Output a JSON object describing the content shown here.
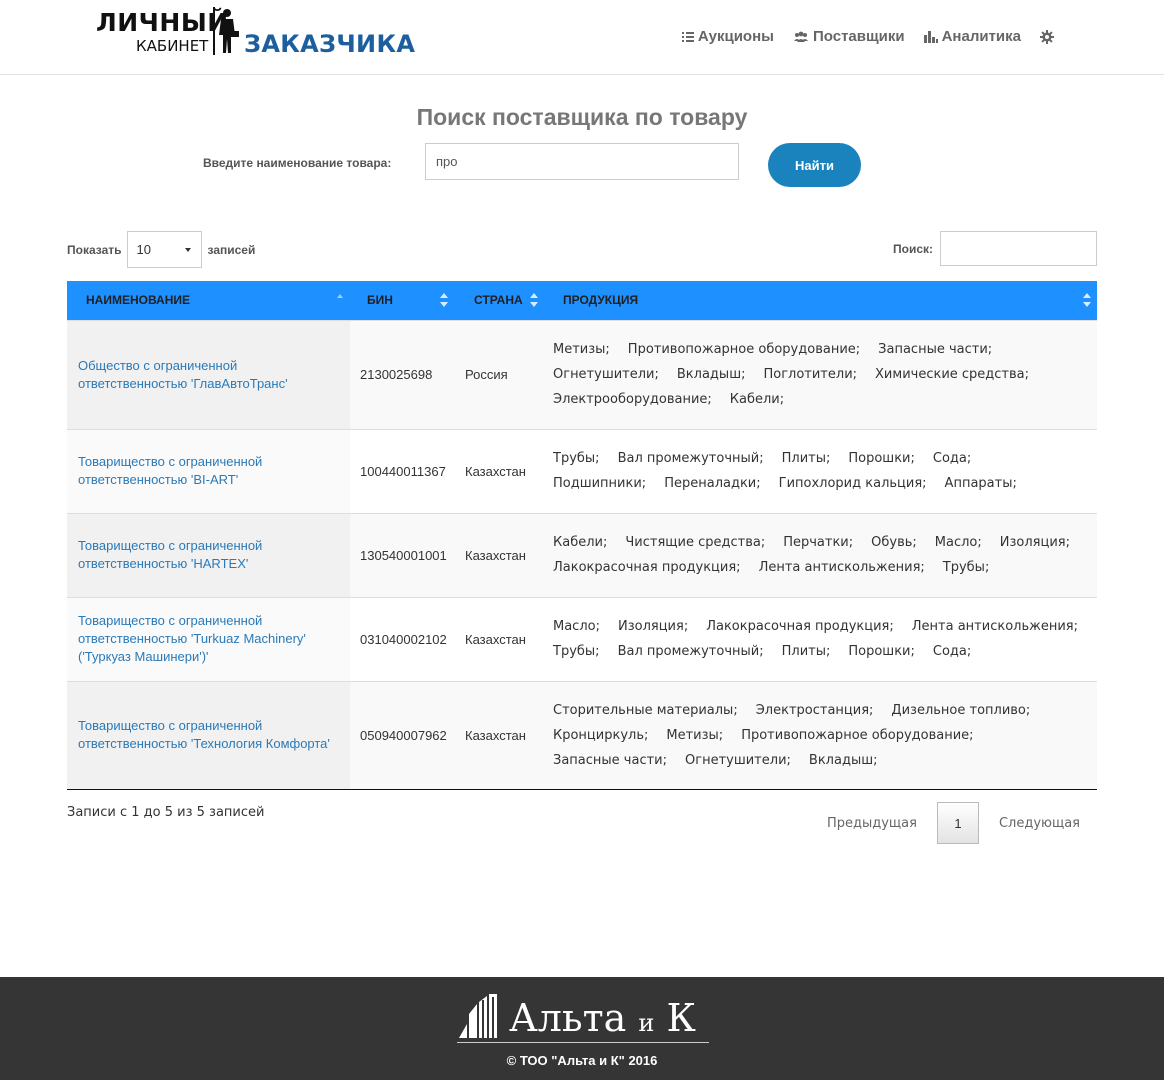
{
  "header": {
    "logo": {
      "line1": "ЛИЧНЫЙ",
      "line2": "КАБИНЕТ",
      "line3": "ЗАКАЗЧИКА"
    },
    "nav": [
      {
        "label": "Аукционы",
        "icon": "list-icon"
      },
      {
        "label": "Поставщики",
        "icon": "users-icon"
      },
      {
        "label": "Аналитика",
        "icon": "bar-chart-icon"
      }
    ],
    "settings_icon": "gear-icon"
  },
  "search": {
    "title": "Поиск поставщика по товару",
    "label": "Введите наименование товара:",
    "value": "про",
    "button": "Найти"
  },
  "table_controls": {
    "show_label": "Показать",
    "page_length": "10",
    "records_label": "записей",
    "filter_label": "Поиск:",
    "filter_value": ""
  },
  "table": {
    "columns": [
      "НАИМЕНОВАНИЕ",
      "БИН",
      "СТРАНА",
      "ПРОДУКЦИЯ"
    ],
    "rows": [
      {
        "name_lines": [
          "Общество с ограниченной",
          "ответственностью 'ГлавАвтоТранс'"
        ],
        "bin": "2130025698",
        "country": "Россия",
        "products": [
          [
            "Метизы;",
            "Противопожарное оборудование;",
            "Запасные части;"
          ],
          [
            "Огнетушители;",
            "Вкладыш;",
            "Поглотители;",
            "Химические средства;"
          ],
          [
            "Электрооборудование;",
            "Кабели;"
          ]
        ]
      },
      {
        "name_lines": [
          "Товарищество с ограниченной",
          "ответственностью 'BI-ART'"
        ],
        "bin": "100440011367",
        "country": "Казахстан",
        "products": [
          [
            "Трубы;",
            "Вал промежуточный;",
            "Плиты;",
            "Порошки;",
            "Сода;"
          ],
          [
            "Подшипники;",
            "Переналадки;",
            "Гипохлорид кальция;",
            "Аппараты;"
          ]
        ]
      },
      {
        "name_lines": [
          "Товарищество с ограниченной",
          "ответственностью 'HARTEX'"
        ],
        "bin": "130540001001",
        "country": "Казахстан",
        "products": [
          [
            "Кабели;",
            "Чистящие средства;",
            "Перчатки;",
            "Обувь;",
            "Масло;",
            "Изоляция;"
          ],
          [
            "Лакокрасочная продукция;",
            "Лента антискольжения;",
            "Трубы;"
          ]
        ]
      },
      {
        "name_lines": [
          "Товарищество с ограниченной",
          "ответственностью 'Turkuaz Machinery'",
          "('Туркуаз Машинери')'"
        ],
        "bin": "031040002102",
        "country": "Казахстан",
        "products": [
          [
            "Масло;",
            "Изоляция;",
            "Лакокрасочная продукция;",
            "Лента антискольжения;"
          ],
          [
            "Трубы;",
            "Вал промежуточный;",
            "Плиты;",
            "Порошки;",
            "Сода;"
          ]
        ]
      },
      {
        "name_lines": [
          "Товарищество с ограниченной",
          "ответственностью 'Технология Комфорта'"
        ],
        "bin": "050940007962",
        "country": "Казахстан",
        "products": [
          [
            "Сторительные материалы;",
            "Электростанция;",
            "Дизельное топливо;"
          ],
          [
            "Кронциркуль;",
            "Метизы;",
            "Противопожарное оборудование;"
          ],
          [
            "Запасные части;",
            "Огнетушители;",
            "Вкладыш;"
          ]
        ]
      }
    ]
  },
  "info": "Записи с 1 до 5 из 5 записей",
  "pagination": {
    "prev": "Предыдущая",
    "current": "1",
    "next": "Следующая"
  },
  "footer": {
    "brand_a": "Альта",
    "brand_b": "и",
    "brand_c": "К",
    "copyright": "© ТОО \"Альта и К\" 2016"
  },
  "colors": {
    "header_row": "#1e90ff",
    "button": "#1a83bd",
    "link": "#2a7ab8",
    "footer": "#353535",
    "logo_blue": "#1d5f9e"
  }
}
